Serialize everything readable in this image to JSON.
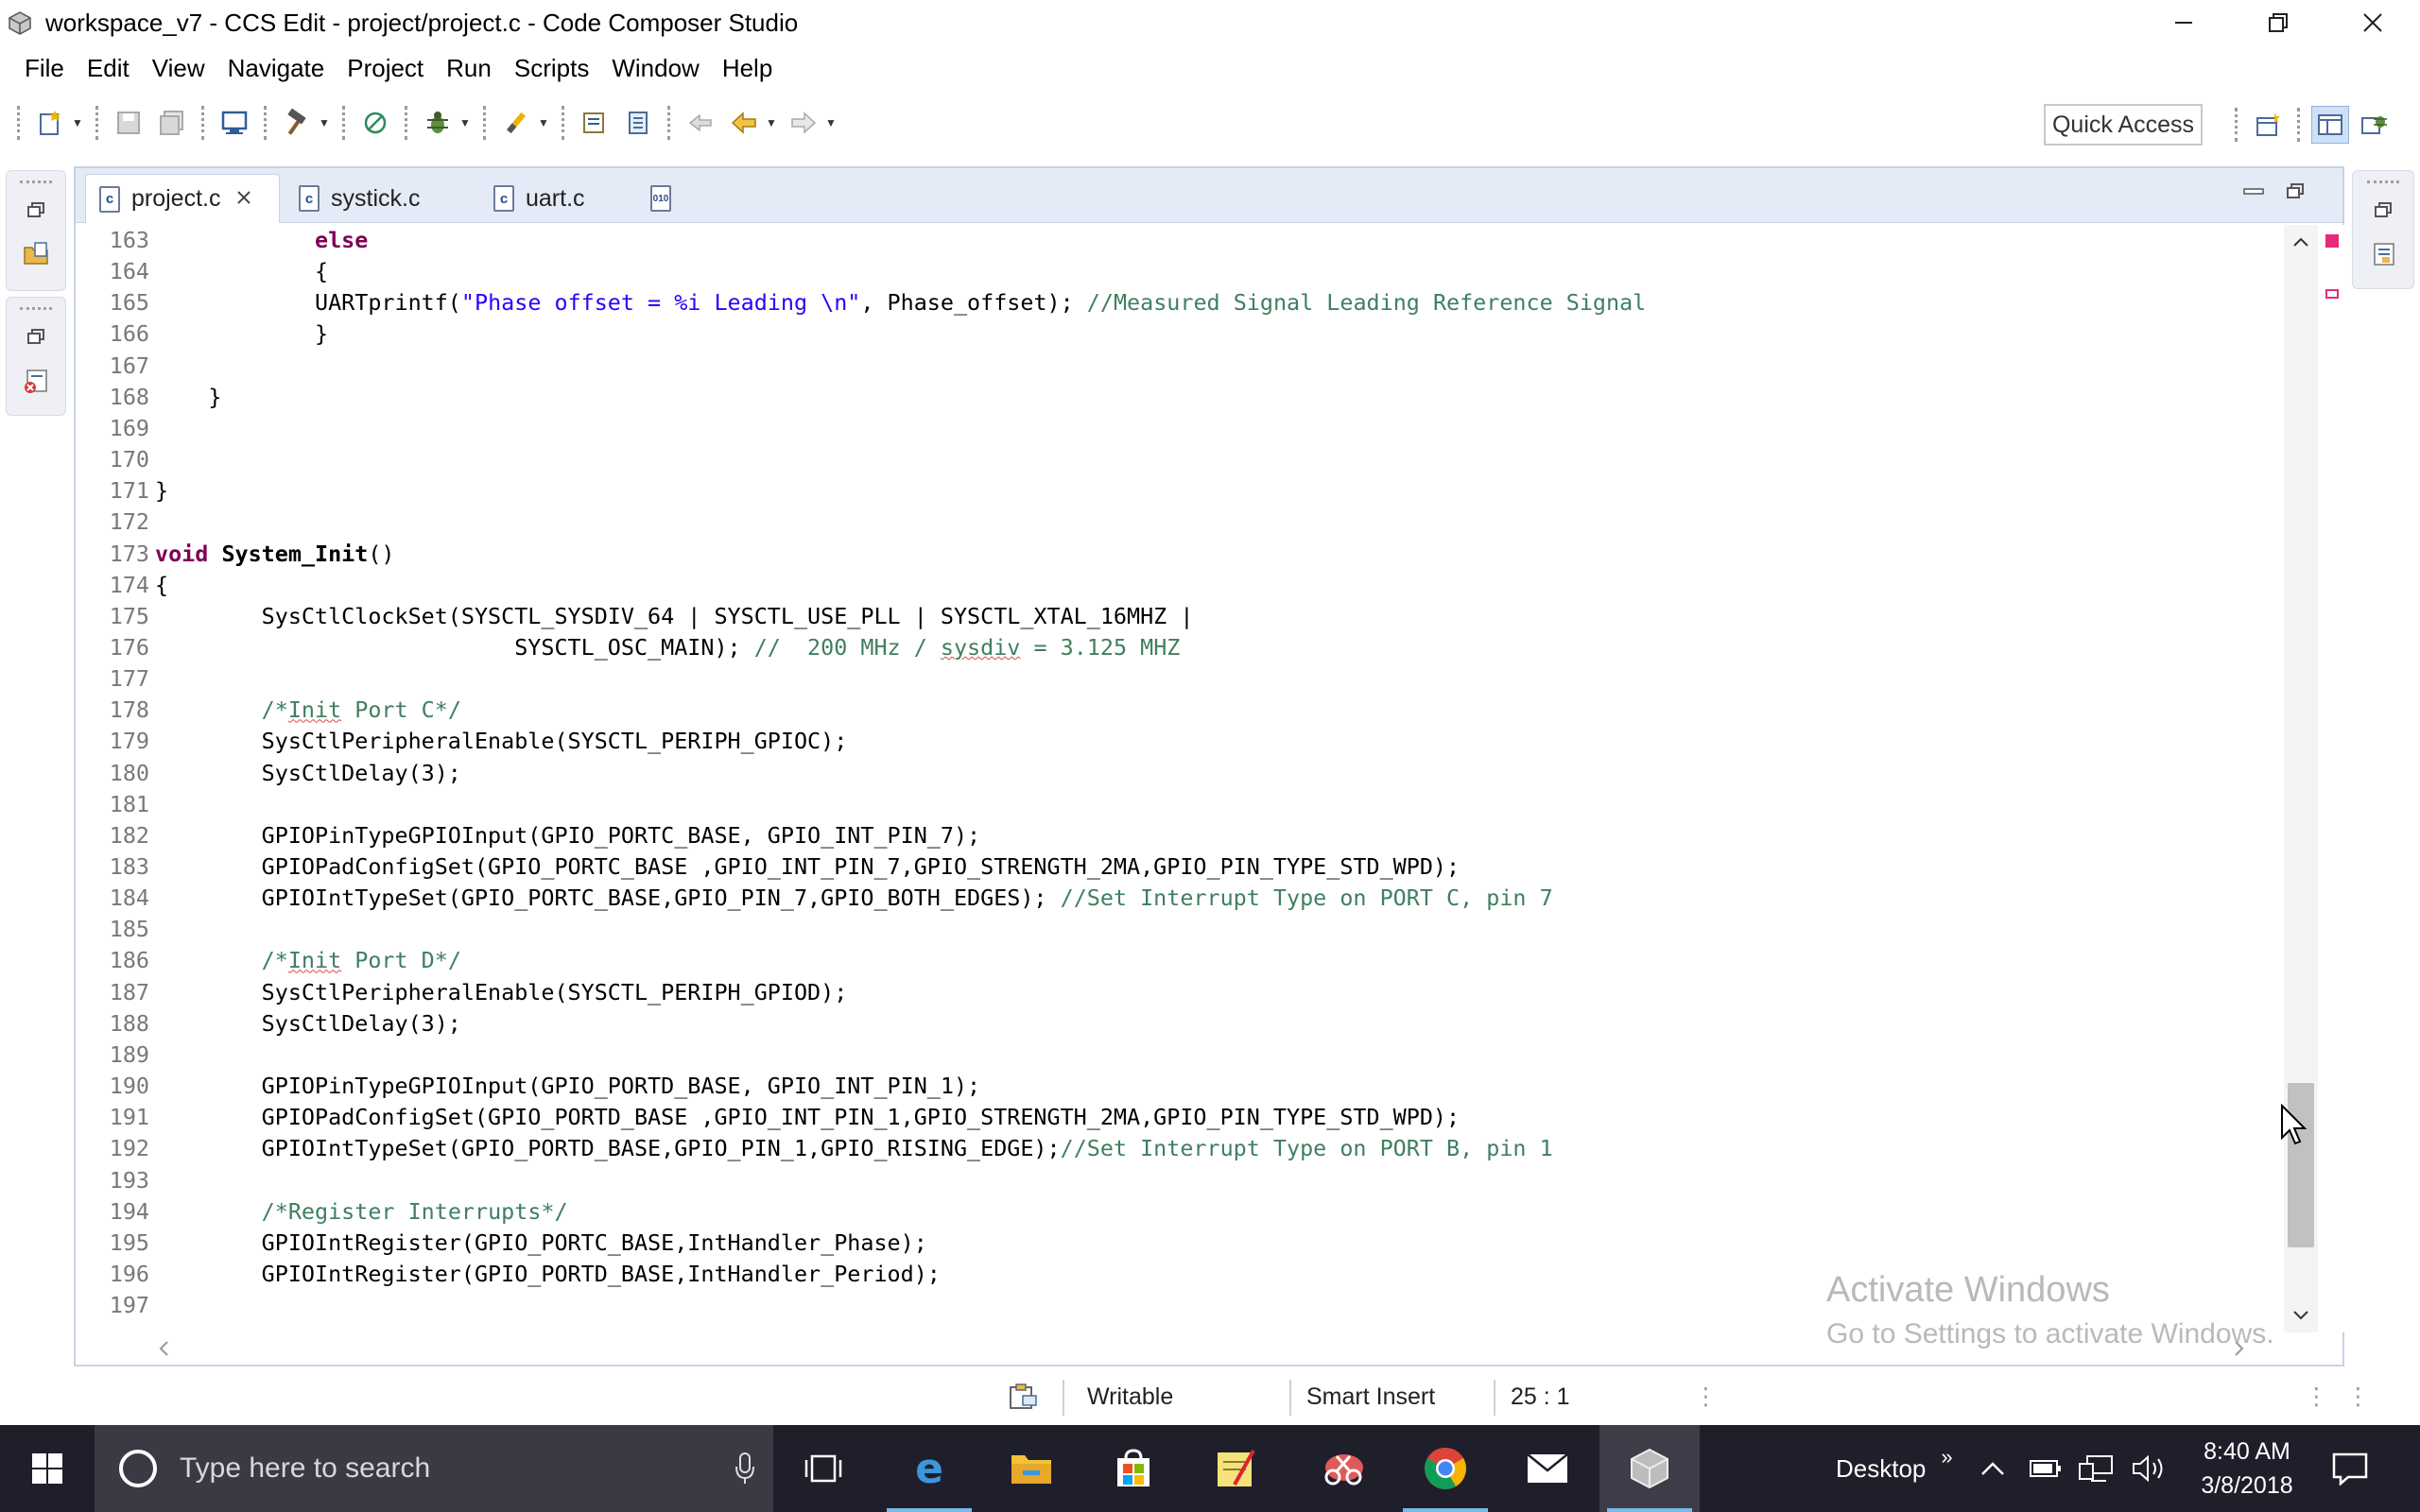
{
  "window": {
    "title": "workspace_v7 - CCS Edit - project/project.c - Code Composer Studio",
    "app_icon": "ccs-cube-icon",
    "controls": [
      "minimize",
      "restore",
      "close"
    ]
  },
  "menu": [
    "File",
    "Edit",
    "View",
    "Navigate",
    "Project",
    "Run",
    "Scripts",
    "Window",
    "Help"
  ],
  "toolbar": {
    "quick_access": "Quick Access"
  },
  "editor": {
    "tabs": [
      {
        "label": "project.c",
        "active": true,
        "icon": "c-file-icon"
      },
      {
        "label": "systick.c",
        "active": false,
        "icon": "c-file-icon"
      },
      {
        "label": "uart.c",
        "active": false,
        "icon": "c-file-icon"
      },
      {
        "label": "",
        "active": false,
        "icon": "binary-file-icon"
      }
    ],
    "lines": [
      {
        "n": "163",
        "t": "            else"
      },
      {
        "n": "164",
        "t": "            {"
      },
      {
        "n": "165",
        "t": "            UARTprintf(\"Phase offset = %i Leading \\n\", Phase_offset); //Measured Signal Leading Reference Signal"
      },
      {
        "n": "166",
        "t": "            }"
      },
      {
        "n": "167",
        "t": ""
      },
      {
        "n": "168",
        "t": "    }"
      },
      {
        "n": "169",
        "t": ""
      },
      {
        "n": "170",
        "t": ""
      },
      {
        "n": "171",
        "t": "}"
      },
      {
        "n": "172",
        "t": ""
      },
      {
        "n": "173",
        "t": "void System_Init()"
      },
      {
        "n": "174",
        "t": "{"
      },
      {
        "n": "175",
        "t": "        SysCtlClockSet(SYSCTL_SYSDIV_64 | SYSCTL_USE_PLL | SYSCTL_XTAL_16MHZ |"
      },
      {
        "n": "176",
        "t": "                           SYSCTL_OSC_MAIN); //  200 MHz / sysdiv = 3.125 MHZ"
      },
      {
        "n": "177",
        "t": ""
      },
      {
        "n": "178",
        "t": "        /*Init Port C*/"
      },
      {
        "n": "179",
        "t": "        SysCtlPeripheralEnable(SYSCTL_PERIPH_GPIOC);"
      },
      {
        "n": "180",
        "t": "        SysCtlDelay(3);"
      },
      {
        "n": "181",
        "t": ""
      },
      {
        "n": "182",
        "t": "        GPIOPinTypeGPIOInput(GPIO_PORTC_BASE, GPIO_INT_PIN_7);"
      },
      {
        "n": "183",
        "t": "        GPIOPadConfigSet(GPIO_PORTC_BASE ,GPIO_INT_PIN_7,GPIO_STRENGTH_2MA,GPIO_PIN_TYPE_STD_WPD);"
      },
      {
        "n": "184",
        "t": "        GPIOIntTypeSet(GPIO_PORTC_BASE,GPIO_PIN_7,GPIO_BOTH_EDGES); //Set Interrupt Type on PORT C, pin 7"
      },
      {
        "n": "185",
        "t": ""
      },
      {
        "n": "186",
        "t": "        /*Init Port D*/"
      },
      {
        "n": "187",
        "t": "        SysCtlPeripheralEnable(SYSCTL_PERIPH_GPIOD);"
      },
      {
        "n": "188",
        "t": "        SysCtlDelay(3);"
      },
      {
        "n": "189",
        "t": ""
      },
      {
        "n": "190",
        "t": "        GPIOPinTypeGPIOInput(GPIO_PORTD_BASE, GPIO_INT_PIN_1);"
      },
      {
        "n": "191",
        "t": "        GPIOPadConfigSet(GPIO_PORTD_BASE ,GPIO_INT_PIN_1,GPIO_STRENGTH_2MA,GPIO_PIN_TYPE_STD_WPD);"
      },
      {
        "n": "192",
        "t": "        GPIOIntTypeSet(GPIO_PORTD_BASE,GPIO_PIN_1,GPIO_RISING_EDGE);//Set Interrupt Type on PORT B, pin 1"
      },
      {
        "n": "193",
        "t": ""
      },
      {
        "n": "194",
        "t": "        /*Register Interrupts*/"
      },
      {
        "n": "195",
        "t": "        GPIOIntRegister(GPIO_PORTC_BASE,IntHandler_Phase);"
      },
      {
        "n": "196",
        "t": "        GPIOIntRegister(GPIO_PORTD_BASE,IntHandler_Period);"
      },
      {
        "n": "197",
        "t": ""
      }
    ]
  },
  "watermark": {
    "line1": "Activate Windows",
    "line2": "Go to Settings to activate Windows."
  },
  "status": {
    "writable": "Writable",
    "insert_mode": "Smart Insert",
    "position": "25 : 1"
  },
  "taskbar": {
    "search_placeholder": "Type here to search",
    "desktop_label": "Desktop",
    "time": "8:40 AM",
    "date": "3/8/2018",
    "apps": [
      "task-view-icon",
      "edge-icon",
      "file-explorer-icon",
      "store-icon",
      "sticky-notes-icon",
      "snipping-icon",
      "chrome-icon",
      "mail-icon",
      "ccs-icon"
    ]
  },
  "colors": {
    "keyword": "#7f0055",
    "string": "#2a00ff",
    "comment": "#3f7f5f",
    "line_number": "#787878",
    "tab_bar": "#e4ebf7",
    "taskbar": "#1f1f2b"
  }
}
